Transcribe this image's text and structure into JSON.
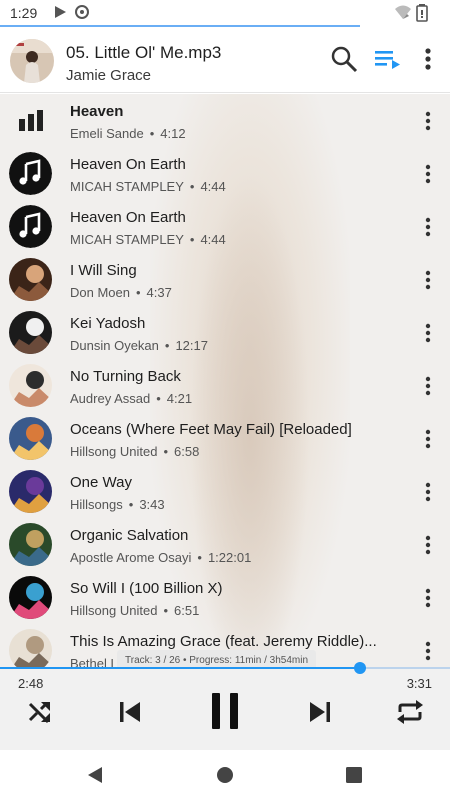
{
  "status_bar": {
    "time": "1:29",
    "icons": [
      "play-icon",
      "at-sign-icon",
      "wifi-icon",
      "battery-icon"
    ]
  },
  "now_playing": {
    "title": "05. Little Ol' Me.mp3",
    "artist": "Jamie Grace"
  },
  "header": {
    "actions": [
      "search-icon",
      "queue-icon",
      "more-vert-icon"
    ],
    "accent": "#2196f3"
  },
  "tracks": [
    {
      "title": "Heaven",
      "artist": "Emeli Sande",
      "duration": "4:12",
      "active": true,
      "art": "equalizer"
    },
    {
      "title": "Heaven On Earth",
      "artist": "MICAH STAMPLEY",
      "duration": "4:44",
      "art": "music-note"
    },
    {
      "title": "Heaven On Earth",
      "artist": "MICAH STAMPLEY",
      "duration": "4:44",
      "art": "music-note"
    },
    {
      "title": "I Will Sing",
      "artist": "Don Moen",
      "duration": "4:37",
      "art": "album"
    },
    {
      "title": "Kei Yadosh",
      "artist": "Dunsin Oyekan",
      "duration": "12:17",
      "art": "album"
    },
    {
      "title": "No Turning Back",
      "artist": "Audrey Assad",
      "duration": "4:21",
      "art": "album"
    },
    {
      "title": "Oceans (Where Feet May Fail) [Reloaded]",
      "artist": "Hillsong United",
      "duration": "6:58",
      "art": "album"
    },
    {
      "title": "One Way",
      "artist": "Hillsongs",
      "duration": "3:43",
      "art": "album"
    },
    {
      "title": "Organic Salvation",
      "artist": "Apostle Arome Osayi",
      "duration": "1:22:01",
      "art": "album"
    },
    {
      "title": "So Will I (100 Billion X)",
      "artist": "Hillsong United",
      "duration": "6:51",
      "art": "album"
    },
    {
      "title": "This Is Amazing Grace (feat. Jeremy Riddle)...",
      "artist": "Bethel L",
      "duration": "",
      "art": "album"
    }
  ],
  "progress_info": "Track: 3 / 26 • Progress: 11min / 3h54min",
  "player": {
    "elapsed": "2:48",
    "total": "3:31",
    "seek_fraction": 0.8,
    "controls": [
      "shuffle-icon",
      "skip-previous-icon",
      "pause-icon",
      "skip-next-icon",
      "repeat-icon"
    ]
  },
  "nav": [
    "back-icon",
    "home-icon",
    "recents-icon"
  ]
}
